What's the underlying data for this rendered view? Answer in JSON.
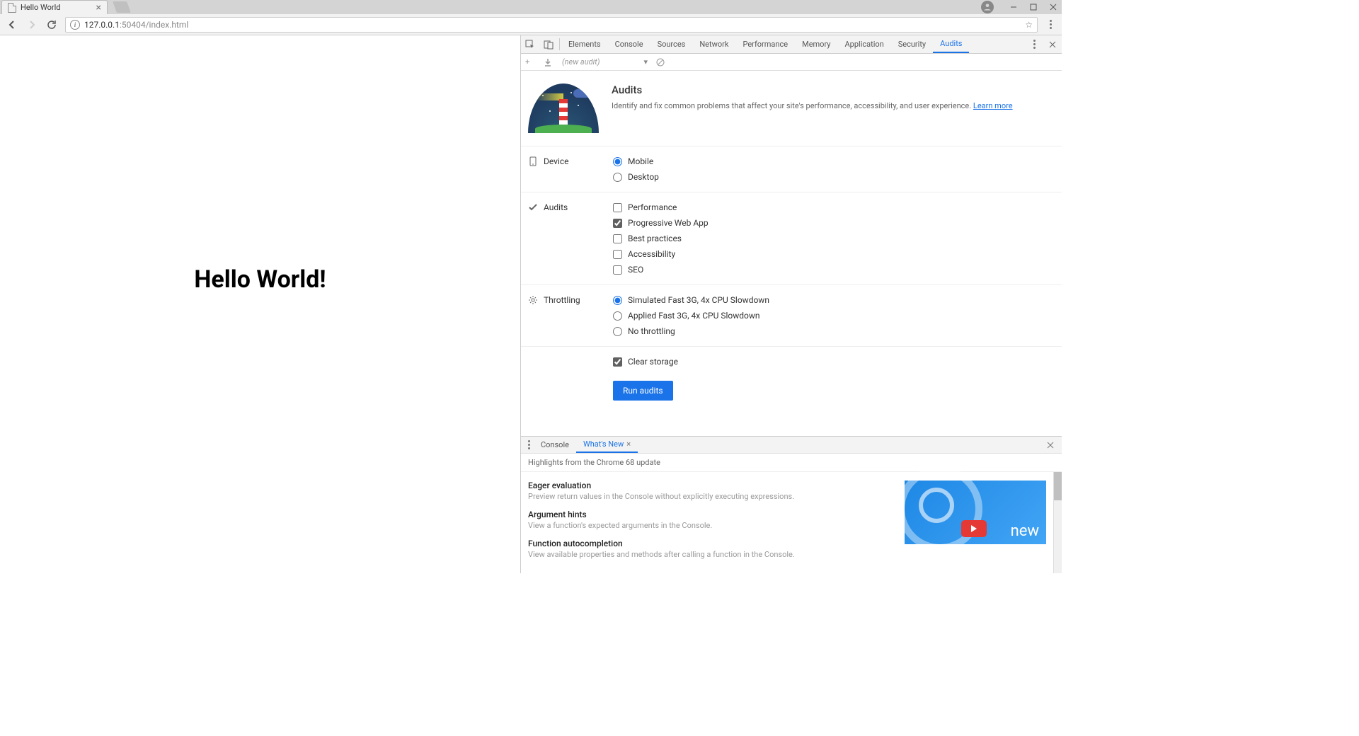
{
  "browser": {
    "tab_title": "Hello World",
    "url_host": "127.0.0.1",
    "url_path": ":50404/index.html"
  },
  "page": {
    "heading": "Hello World!"
  },
  "devtools": {
    "tabs": [
      "Elements",
      "Console",
      "Sources",
      "Network",
      "Performance",
      "Memory",
      "Application",
      "Security",
      "Audits"
    ],
    "active_tab": "Audits",
    "subbar_label": "(new audit)",
    "intro_heading": "Audits",
    "intro_text": "Identify and fix common problems that affect your site's performance, accessibility, and user experience.",
    "intro_link": "Learn more",
    "sections": {
      "device": {
        "label": "Device",
        "options": [
          "Mobile",
          "Desktop"
        ],
        "selected": "Mobile"
      },
      "audits": {
        "label": "Audits",
        "options": [
          {
            "label": "Performance",
            "checked": false
          },
          {
            "label": "Progressive Web App",
            "checked": true
          },
          {
            "label": "Best practices",
            "checked": false
          },
          {
            "label": "Accessibility",
            "checked": false
          },
          {
            "label": "SEO",
            "checked": false
          }
        ]
      },
      "throttling": {
        "label": "Throttling",
        "options": [
          "Simulated Fast 3G, 4x CPU Slowdown",
          "Applied Fast 3G, 4x CPU Slowdown",
          "No throttling"
        ],
        "selected": "Simulated Fast 3G, 4x CPU Slowdown"
      },
      "clear_storage": {
        "label": "Clear storage",
        "checked": true
      }
    },
    "run_button": "Run audits"
  },
  "drawer": {
    "tabs": [
      "Console",
      "What's New"
    ],
    "active_tab": "What's New",
    "subtitle": "Highlights from the Chrome 68 update",
    "highlights": [
      {
        "title": "Eager evaluation",
        "desc": "Preview return values in the Console without explicitly executing expressions."
      },
      {
        "title": "Argument hints",
        "desc": "View a function's expected arguments in the Console."
      },
      {
        "title": "Function autocompletion",
        "desc": "View available properties and methods after calling a function in the Console."
      }
    ],
    "promo_word": "new"
  }
}
